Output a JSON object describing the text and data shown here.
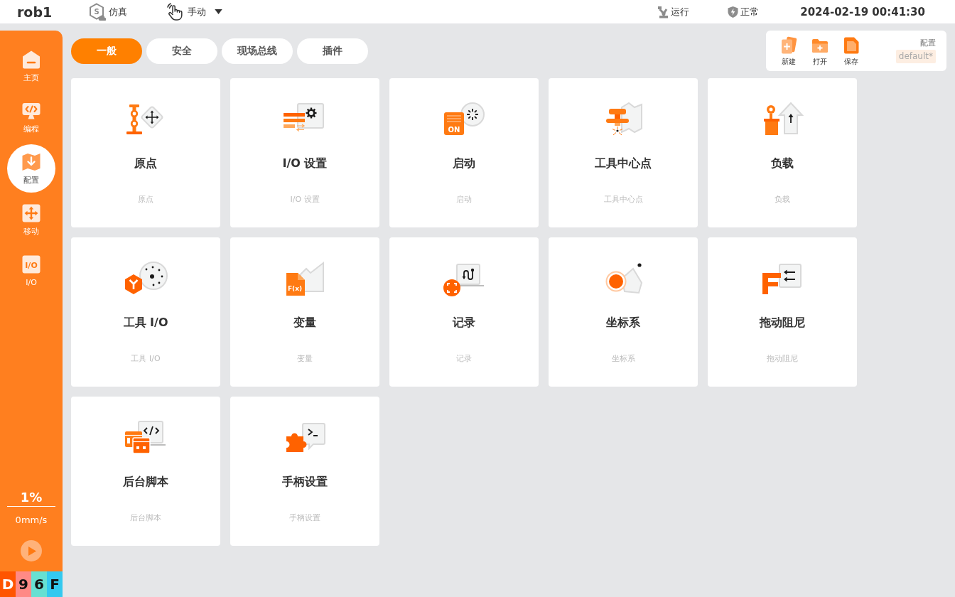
{
  "top_bar": {
    "title": "rob1",
    "mode": {
      "icon_label": "S",
      "label": "仿真"
    },
    "control": {
      "label": "手动"
    },
    "run_state": {
      "label": "运行"
    },
    "safety": {
      "label": "正常"
    },
    "datetime": "2024-02-19 00:41:30"
  },
  "sidebar": {
    "items": [
      {
        "label": "主页",
        "selected": false
      },
      {
        "label": "编程",
        "selected": false
      },
      {
        "label": "配置",
        "selected": true
      },
      {
        "label": "移动",
        "selected": false
      },
      {
        "label": "I/O",
        "selected": false,
        "icon_label": "I/O"
      }
    ],
    "speed_percent": "1%",
    "speed": "0mm/s",
    "status_codes": [
      {
        "text": "D",
        "color": "#ff5500"
      },
      {
        "text": "9",
        "color": "#ff8a86"
      },
      {
        "text": "6",
        "color": "#66e0d2"
      },
      {
        "text": "F",
        "color": "#33c9ef"
      }
    ]
  },
  "tabs": [
    {
      "label": "一般",
      "selected": true
    },
    {
      "label": "安全",
      "selected": false
    },
    {
      "label": "现场总线",
      "selected": false
    },
    {
      "label": "插件",
      "selected": false
    }
  ],
  "config_panel": {
    "actions": [
      "新建",
      "打开",
      "保存"
    ],
    "title": "配置",
    "name": "default*"
  },
  "cards": [
    {
      "title": "原点",
      "subtitle": "原点"
    },
    {
      "title": "I/O 设置",
      "subtitle": "I/O 设置"
    },
    {
      "title": "启动",
      "subtitle": "启动",
      "icon_label": "ON"
    },
    {
      "title": "工具中心点",
      "subtitle": "工具中心点"
    },
    {
      "title": "负载",
      "subtitle": "负载"
    },
    {
      "title": "工具 I/O",
      "subtitle": "工具 I/O"
    },
    {
      "title": "变量",
      "subtitle": "变量",
      "icon_label": "F(x)"
    },
    {
      "title": "记录",
      "subtitle": "记录"
    },
    {
      "title": "坐标系",
      "subtitle": "坐标系"
    },
    {
      "title": "拖动阻尼",
      "subtitle": "拖动阻尼"
    },
    {
      "title": "后台脚本",
      "subtitle": "后台脚本"
    },
    {
      "title": "手柄设置",
      "subtitle": "手柄设置"
    }
  ]
}
